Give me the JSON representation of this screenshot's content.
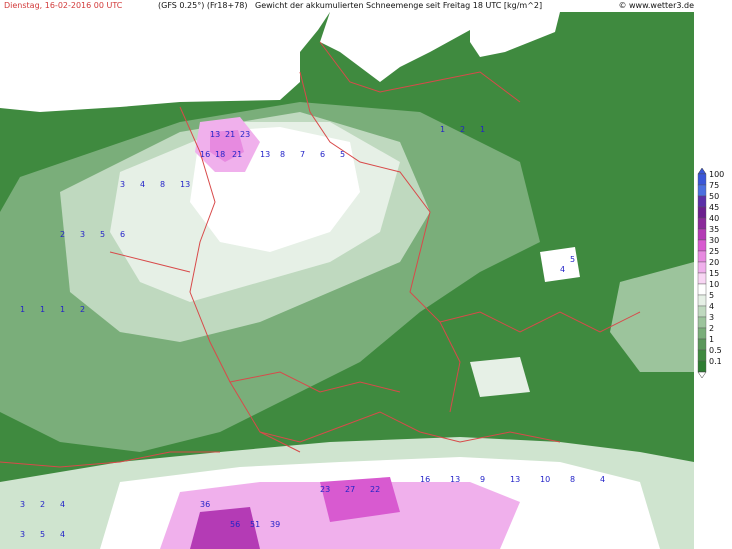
{
  "header": {
    "date": "Dienstag, 16-02-2016   00 UTC",
    "model": "(GFS 0.25°) (Fr18+78)",
    "title": "Gewicht der akkumulierten Schneemenge seit Freitag 18 UTC [kg/m^2]",
    "copyright": "© www.wetter3.de"
  },
  "legend": {
    "labels": [
      "100",
      "75",
      "50",
      "45",
      "40",
      "35",
      "30",
      "25",
      "20",
      "15",
      "10",
      "5",
      "4",
      "3",
      "2",
      "1",
      "0.5",
      "0.1"
    ],
    "colors": [
      "#3a56d8",
      "#4b6fe0",
      "#5a2fa8",
      "#6b1f8e",
      "#8a2a9a",
      "#b43bb5",
      "#d85ad0",
      "#e78ae0",
      "#f0b0ec",
      "#f8d6f4",
      "#ffffff",
      "#e6f0e6",
      "#bfd9bf",
      "#9cc49c",
      "#7aae7a",
      "#5a975a",
      "#3f8a3f",
      "#2e7d32"
    ]
  },
  "map_colors": {
    "land_green": "#3f8a3f",
    "snow_light": "#9cc49c",
    "snow_mid": "#cfe4cf",
    "snow_white": "#ffffff",
    "snow_pink": "#e8a6e4",
    "snow_purple": "#b54fb5",
    "border": "#d84a4a",
    "sea": "#ffffff",
    "values": "#2323c8"
  }
}
